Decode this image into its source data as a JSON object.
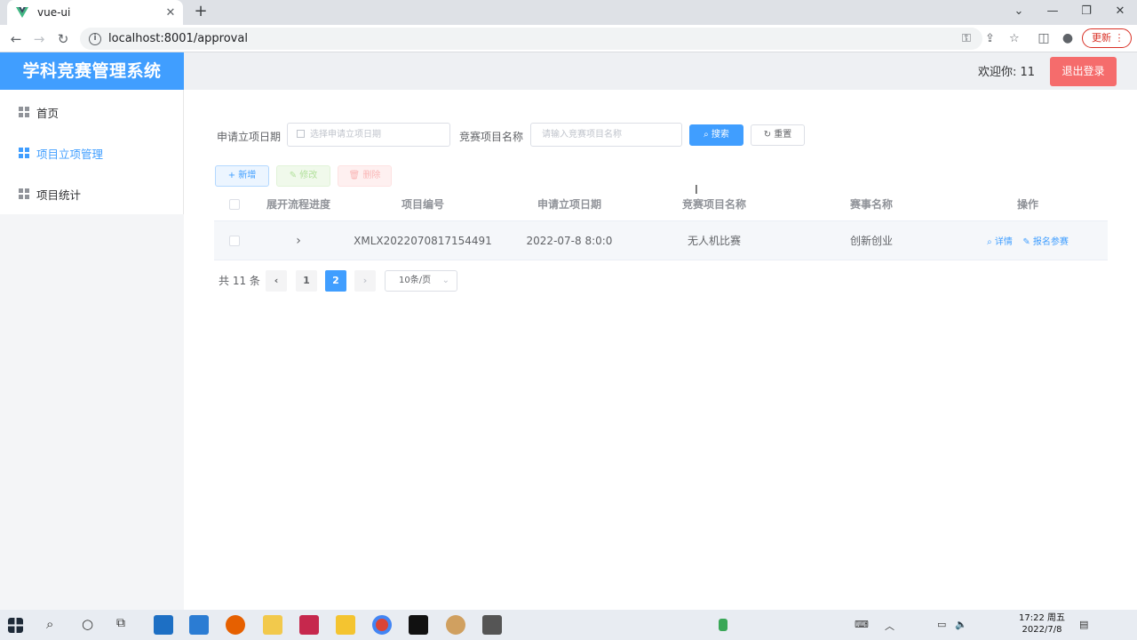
{
  "browser": {
    "tab_title": "vue-ui",
    "url": "localhost:8001/approval",
    "update_label": "更新"
  },
  "app": {
    "logo": "学科竞赛管理系统",
    "welcome": "欢迎你: 11",
    "logout": "退出登录"
  },
  "sidebar": {
    "items": [
      {
        "label": "首页",
        "active": false
      },
      {
        "label": "项目立项管理",
        "active": true
      },
      {
        "label": "项目统计",
        "active": false
      }
    ]
  },
  "filter": {
    "date_label": "申请立项日期",
    "date_placeholder": "选择申请立项日期",
    "name_label": "竞赛项目名称",
    "name_placeholder": "请输入竞赛项目名称",
    "search": "搜索",
    "reset": "重置"
  },
  "toolbar": {
    "add": "新增",
    "edit": "修改",
    "delete": "删除"
  },
  "table": {
    "headers": [
      "展开流程进度",
      "项目编号",
      "申请立项日期",
      "竞赛项目名称",
      "赛事名称",
      "操作"
    ],
    "rows": [
      {
        "expand": "›",
        "code": "XMLX2022070817154491",
        "date": "2022-07-8 8:0:0",
        "project": "无人机比赛",
        "event": "创新创业",
        "action_detail": "详情",
        "action_signup": "报名参赛"
      }
    ]
  },
  "pagination": {
    "total": "共 11 条",
    "pages": [
      "1",
      "2"
    ],
    "current": "2",
    "page_size": "10条/页"
  },
  "taskbar": {
    "time": "17:22 周五",
    "date": "2022/7/8"
  },
  "colors": {
    "primary": "#409eff",
    "danger": "#f56c6c"
  }
}
